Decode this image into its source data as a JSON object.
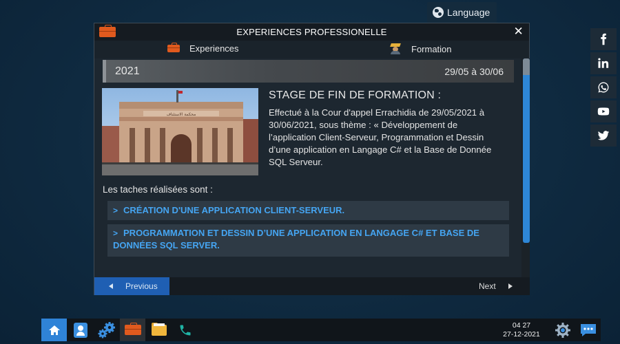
{
  "language": {
    "label": "Language",
    "icon": "globe-icon"
  },
  "social": [
    "facebook-icon",
    "linkedin-icon",
    "whatsapp-icon",
    "youtube-icon",
    "twitter-icon"
  ],
  "window": {
    "title": "EXPERIENCES PROFESSIONELLE",
    "close": "✕",
    "tabs": [
      {
        "label": "Experiences",
        "icon": "briefcase-icon"
      },
      {
        "label": "Formation",
        "icon": "graduate-icon"
      }
    ]
  },
  "experience": {
    "year": "2021",
    "dates": "29/05 à 30/06",
    "title": "STAGE DE FIN DE FORMATION :",
    "description": "Effectué à la Cour d'appel Errachidia de 29/05/2021 à 30/06/2021, sous thème : « Développement de l’application Client-Serveur, Programmation et Dessin d’une application en Langage C# et la Base de Donnée SQL Serveur.",
    "building_sign": "محكمة الاستئناف",
    "tasks_label": "Les taches réalisées sont :",
    "tasks": [
      "CRÉATION D'UNE APPLICATION CLIENT-SERVEUR.",
      "PROGRAMMATION ET DESSIN D’UNE APPLICATION EN LANGAGE C# ET BASE DE DONNÉES SQL SERVER."
    ]
  },
  "footer": {
    "previous": "Previous",
    "next": "Next"
  },
  "taskbar": {
    "icons": [
      "home-icon",
      "contact-card-icon",
      "settings-gears-icon",
      "briefcase-icon",
      "folder-icon",
      "phone-icon"
    ],
    "time": "04 27",
    "date": "27-12-2021",
    "right_icons": [
      "gear-icon",
      "chat-icon"
    ]
  },
  "colors": {
    "accent_blue": "#2e86d6",
    "link_blue": "#45a5f2",
    "briefcase_orange": "#e05a1e",
    "window_bg": "#1d2730"
  }
}
